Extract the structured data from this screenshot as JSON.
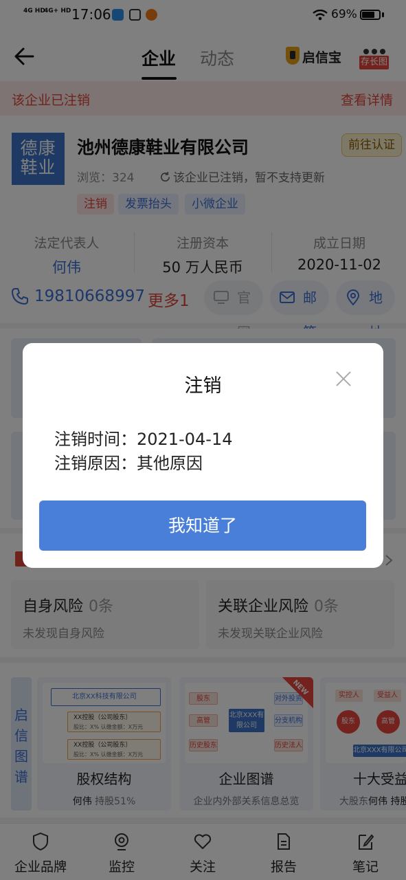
{
  "status_bar": {
    "network_1": "4G HD",
    "network_2": "4G+ HD",
    "time": "17:06",
    "battery_percent": "69%",
    "battery_level": 0.69
  },
  "nav": {
    "tab_company": "企业",
    "tab_dynamics": "动态",
    "brand": "启信宝",
    "save_image_label": "存长图"
  },
  "banner": {
    "status_text": "该企业已注销",
    "details_link": "查看详情"
  },
  "company": {
    "logo_text_line1": "德康",
    "logo_text_line2": "鞋业",
    "name": "池州德康鞋业有限公司",
    "certify_button": "前往认证",
    "views": "浏览：324",
    "refresh_note": "该企业已注销，暂不支持更新",
    "tags": [
      "注销",
      "发票抬头",
      "小微企业"
    ],
    "stats": [
      {
        "label": "法定代表人",
        "value": "何伟"
      },
      {
        "label": "注册资本",
        "value": "50 万人民币"
      },
      {
        "label": "成立日期",
        "value": "2020-11-02"
      }
    ],
    "phone": "19810668997",
    "more_contacts": "更多1",
    "contact_pills": [
      "官网",
      "邮箱",
      "地址"
    ]
  },
  "risk": {
    "self_title": "自身风险",
    "self_count": "0条",
    "self_desc": "未发现自身风险",
    "related_title": "关联企业风险",
    "related_count": "0条",
    "related_desc": "未发现关联企业风险"
  },
  "graph": {
    "side_label": "启信图谱",
    "cards": [
      {
        "title": "股权结构",
        "sub_name": "何伟",
        "sub_rest": " 持股51%"
      },
      {
        "title": "企业图谱",
        "sub_name": "",
        "sub_rest": "企业内外部关系信息总览"
      },
      {
        "title": "十大受益",
        "sub_name": "大股东",
        "sub_rest": "何伟 持股"
      }
    ],
    "equity_preview": {
      "company": "北京XX科技有限公司",
      "holder1_line1": "XX控股（公司股东）",
      "holder1_line2": "股比：X%   认缴金额：X万元",
      "holder2_line1": "XX控股（公司股东）",
      "holder2_line2": "股比：X%   认缴金额：X万元"
    },
    "map_preview": {
      "new_badge": "NEW",
      "nodes": [
        "股东",
        "高管",
        "历史股东",
        "北京XXX有限公司",
        "对外投资",
        "分支机构",
        "历史法人"
      ]
    },
    "benefit_preview": {
      "nodes": [
        "实控人",
        "受益人",
        "股东",
        "高管",
        "北京XXX有限公司"
      ]
    }
  },
  "bottom_nav": [
    "企业品牌",
    "监控",
    "关注",
    "报告",
    "笔记"
  ],
  "dialog": {
    "title": "注销",
    "time_label": "注销时间：",
    "time_value": "2021-04-14",
    "reason_label": "注销原因：",
    "reason_value": "其他原因",
    "confirm_button": "我知道了"
  }
}
